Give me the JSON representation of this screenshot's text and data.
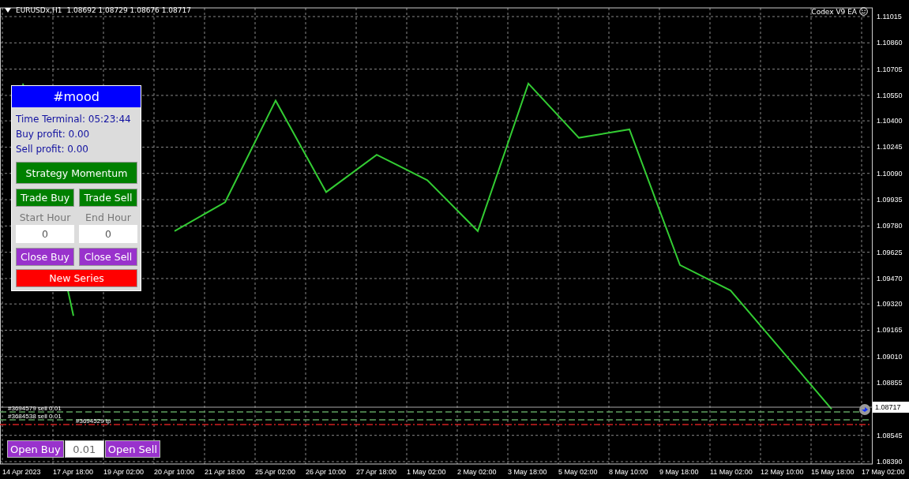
{
  "chart_header": {
    "ohlc": "1.08692 1.08729 1.08676 1.08717"
  },
  "expert_label": "Codex V9 EA",
  "panel": {
    "title": "#mood",
    "info": [
      "Time Terminal: 05:23:44",
      "Buy profit: 0.00",
      "Sell profit: 0.00"
    ],
    "strategy_button": "Strategy Momentum",
    "trade_buttons": [
      "Trade Buy",
      "Trade Sell"
    ],
    "hour_fields": [
      {
        "label": "Start Hour",
        "value": "0"
      },
      {
        "label": "End Hour",
        "value": "0"
      }
    ],
    "close_buttons": [
      "Close Buy",
      "Close Sell"
    ],
    "series_button": "New Series"
  },
  "quick_trade": {
    "buy_label": "Open Buy",
    "lot": "0.01",
    "sell_label": "Open Sell"
  },
  "chart_data": {
    "type": "line",
    "grid": true,
    "categories": [
      "14 Apr 2023",
      "17 Apr 18:00",
      "19 Apr 02:00",
      "20 Apr 10:00",
      "21 Apr 18:00",
      "25 Apr 02:00",
      "26 Apr 10:00",
      "27 Apr 18:00",
      "1 May 02:00",
      "2 May 02:00",
      "3 May 18:00",
      "5 May 02:00",
      "8 May 10:00",
      "9 May 18:00",
      "11 May 02:00",
      "12 May 10:00",
      "15 May 18:00",
      "17 May 02:00"
    ],
    "series": [
      {
        "name": "EURUSDx,H1",
        "color": "#33cc33",
        "values": [
          1.1062,
          1.0925,
          null,
          1.0975,
          1.0992,
          1.1052,
          1.0998,
          1.102,
          1.1005,
          1.0975,
          1.1062,
          1.103,
          1.1035,
          1.0955,
          1.094,
          1.0905,
          1.087,
          null
        ]
      }
    ],
    "ylim": [
      1.0839,
      1.11015
    ],
    "yticks": [
      {
        "value": 1.11015,
        "label": "1.11015"
      },
      {
        "value": 1.1086,
        "label": "1.10860"
      },
      {
        "value": 1.10705,
        "label": "1.10705"
      },
      {
        "value": 1.1055,
        "label": "1.10550"
      },
      {
        "value": 1.104,
        "label": "1.10400"
      },
      {
        "value": 1.10245,
        "label": "1.10245"
      },
      {
        "value": 1.1009,
        "label": "1.10090"
      },
      {
        "value": 1.09935,
        "label": "1.09935"
      },
      {
        "value": 1.0978,
        "label": "1.09780"
      },
      {
        "value": 1.09625,
        "label": "1.09625"
      },
      {
        "value": 1.0947,
        "label": "1.09470"
      },
      {
        "value": 1.0932,
        "label": "1.09320"
      },
      {
        "value": 1.09165,
        "label": "1.09165"
      },
      {
        "value": 1.0901,
        "label": "1.09010"
      },
      {
        "value": 1.08855,
        "label": "1.08855"
      },
      {
        "value": 1.08545,
        "label": "1.08545"
      },
      {
        "value": 1.0839,
        "label": "1.08390"
      }
    ]
  },
  "price_tag": "1.08717",
  "order_lines": [
    {
      "label": "#3694579 sell 0.01",
      "kind": "sell"
    },
    {
      "label": "#3684538 sell 0.01",
      "kind": "sell"
    },
    {
      "label": "#3694529 tp",
      "kind": "tp"
    }
  ]
}
